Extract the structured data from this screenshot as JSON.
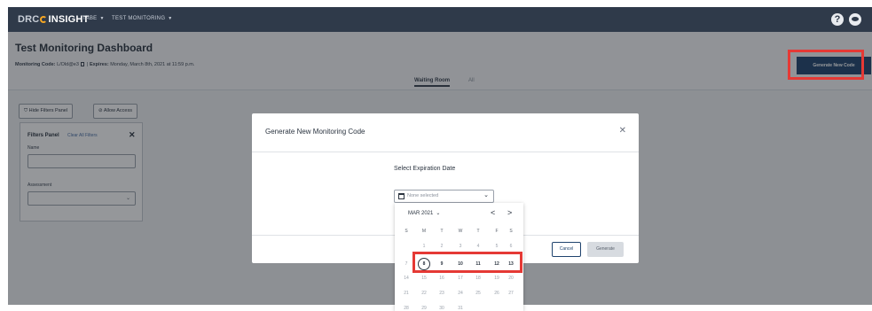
{
  "app": {
    "logo_part1": "DRC",
    "logo_part2": "INSIGHT",
    "nav": [
      {
        "label": "TABE"
      },
      {
        "label": "TEST MONITORING"
      }
    ],
    "help_glyph": "?"
  },
  "dashboard": {
    "title": "Test Monitoring Dashboard",
    "code_label": "Monitoring Code:",
    "code_value": "L/Old@e3",
    "expires_label": "Expires:",
    "expires_value": "Monday, March 8th, 2021 at 11:59 p.m.",
    "separator": "|",
    "tabs": [
      {
        "label": "Waiting Room"
      },
      {
        "label": "All"
      }
    ],
    "generate_new_code_label": "Generate New Code",
    "hide_filters_label": "Hide Filters Panel",
    "allow_access_label": "Allow Access"
  },
  "filters_panel": {
    "title": "Filters Panel",
    "clear_label": "Clear All Filters",
    "close_glyph": "✕",
    "name_label": "Name",
    "assessment_label": "Assessment"
  },
  "modal": {
    "title": "Generate New Monitoring Code",
    "close_glyph": "✕",
    "expiration_label": "Select Expiration Date",
    "date_placeholder": "None selected",
    "cancel_label": "Cancel",
    "generate_label": "Generate"
  },
  "calendar": {
    "month_label": "MAR 2021",
    "prev_glyph": "<",
    "next_glyph": ">",
    "day_headers": [
      "S",
      "M",
      "T",
      "W",
      "T",
      "F",
      "S"
    ],
    "weeks": [
      [
        "",
        "1",
        "2",
        "3",
        "4",
        "5",
        "6"
      ],
      [
        "7",
        "8",
        "9",
        "10",
        "11",
        "12",
        "13"
      ],
      [
        "14",
        "15",
        "16",
        "17",
        "18",
        "19",
        "20"
      ],
      [
        "21",
        "22",
        "23",
        "24",
        "25",
        "26",
        "27"
      ],
      [
        "28",
        "29",
        "30",
        "31",
        "",
        "",
        ""
      ]
    ],
    "selected_day": "8",
    "first_selectable_day": "8",
    "last_selectable_day": "13"
  },
  "colors": {
    "topbar": "#2f3a4a",
    "primary_button": "#20446e",
    "highlight": "#e53935"
  }
}
